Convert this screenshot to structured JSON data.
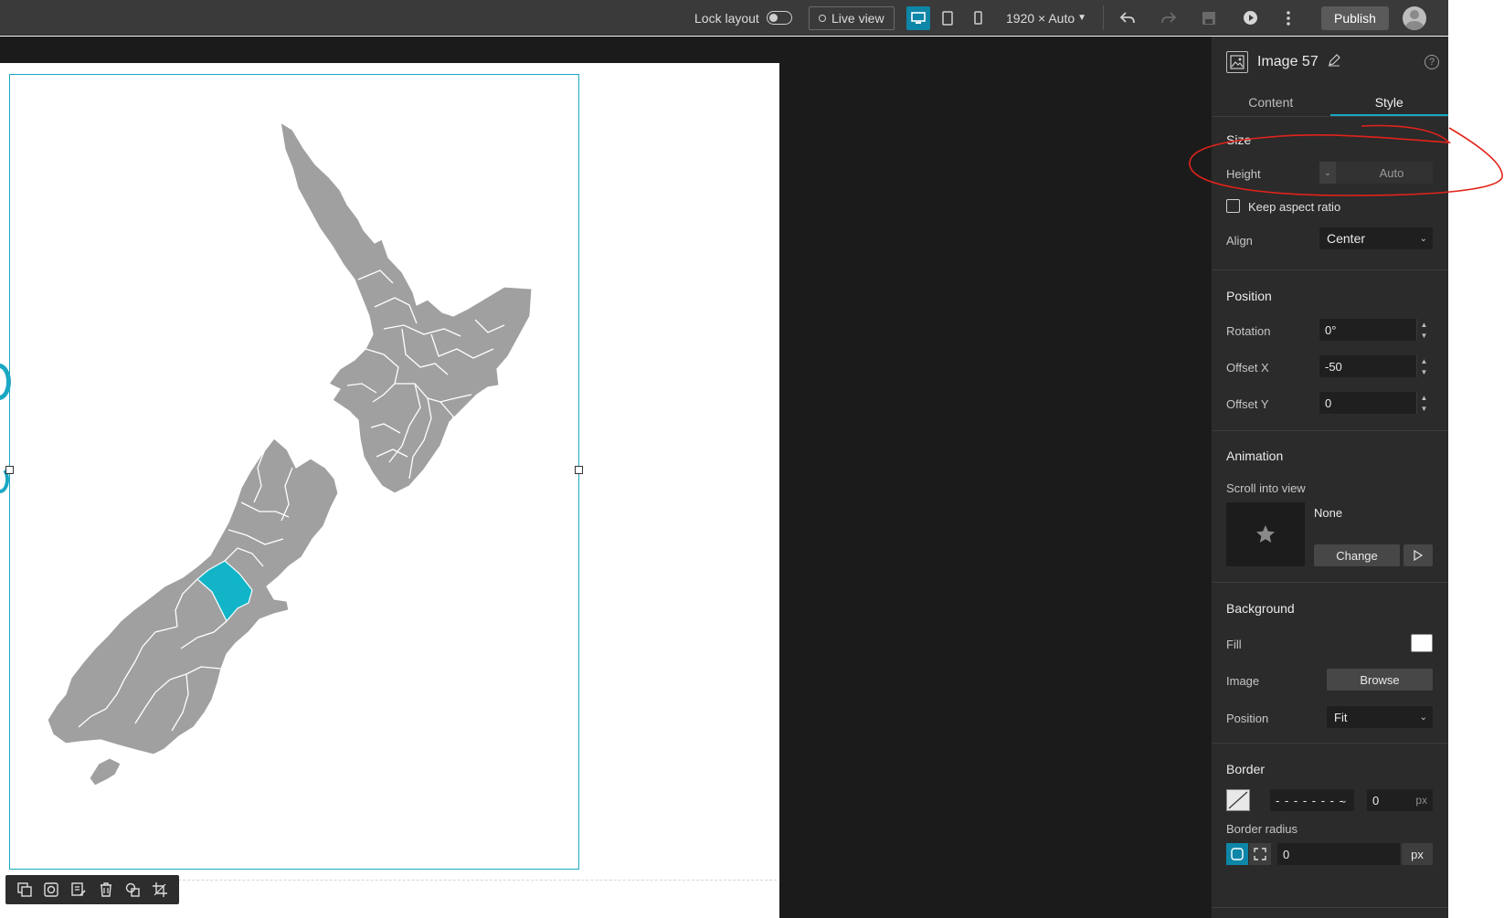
{
  "topbar": {
    "lock_layout_label": "Lock layout",
    "live_view_label": "Live view",
    "resolution_label": "1920 × Auto",
    "publish_label": "Publish"
  },
  "panel": {
    "element_title": "Image 57",
    "help_label": "?",
    "tabs": [
      {
        "label": "Content",
        "active": false
      },
      {
        "label": "Style",
        "active": true
      }
    ],
    "size": {
      "section_title": "Size",
      "height_label": "Height",
      "height_value": "Auto",
      "keep_aspect_ratio_label": "Keep aspect ratio",
      "keep_aspect_ratio_checked": false,
      "align_label": "Align",
      "align_value": "Center"
    },
    "position": {
      "section_title": "Position",
      "rotation_label": "Rotation",
      "rotation_value": "0°",
      "offset_x_label": "Offset X",
      "offset_x_value": "-50",
      "offset_y_label": "Offset Y",
      "offset_y_value": "0"
    },
    "animation": {
      "section_title": "Animation",
      "scroll_into_view_label": "Scroll into view",
      "current_value": "None",
      "change_label": "Change"
    },
    "background": {
      "section_title": "Background",
      "fill_label": "Fill",
      "fill_color": "#ffffff",
      "image_label": "Image",
      "browse_label": "Browse",
      "position_label": "Position",
      "position_value": "Fit"
    },
    "border": {
      "section_title": "Border",
      "style_value": "- - - - - - - -",
      "width_value": "0",
      "width_unit": "px",
      "radius_label": "Border radius",
      "radius_value": "0",
      "radius_unit": "px"
    }
  },
  "canvas": {
    "highlight_color": "#12b5c7",
    "map_color": "#a0a0a0"
  }
}
